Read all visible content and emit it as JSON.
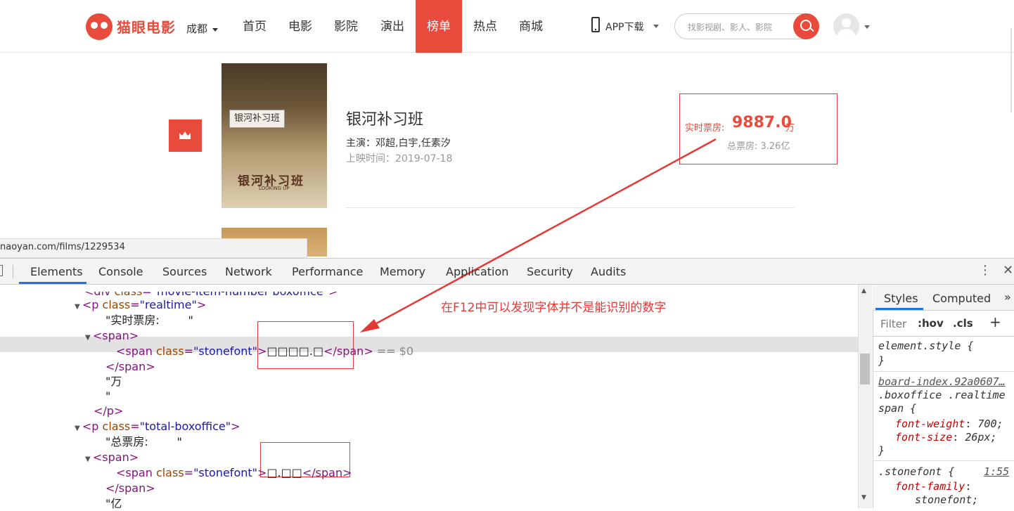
{
  "header": {
    "logo_text": "猫眼电影",
    "city": "成都",
    "nav": [
      "首页",
      "电影",
      "影院",
      "演出",
      "榜单",
      "热点",
      "商城"
    ],
    "active_nav": "榜单",
    "app_download": "APP下载",
    "search_placeholder": "找影视剧、影人、影院"
  },
  "movie": {
    "poster_tag": "银河补习班",
    "poster_title": "银河补习班",
    "poster_subtitle": "LOOKING UP",
    "title": "银河补习班",
    "cast": "主演：邓超,白宇,任素汐",
    "release": "上映时间：2019-07-18",
    "realtime_label": "实时票房:",
    "realtime_value": "9887.0",
    "realtime_unit": "万",
    "total_boxoffice": "总票房: 3.26亿"
  },
  "status_url": "naoyan.com/films/1229534",
  "devtools": {
    "tabs": [
      "Elements",
      "Console",
      "Sources",
      "Network",
      "Performance",
      "Memory",
      "Application",
      "Security",
      "Audits"
    ],
    "active_tab": "Elements",
    "code_lines": [
      {
        "indent": 120,
        "arrow": "",
        "parts": [
          [
            "tg",
            "<div "
          ],
          [
            "an",
            "class"
          ],
          [
            "tg",
            "="
          ],
          [
            "av",
            "\"movie-item-number boxoffice\""
          ],
          [
            "tg",
            ">"
          ]
        ],
        "cut": true
      },
      {
        "indent": 120,
        "arrow": "▼",
        "parts": [
          [
            "tg",
            "<p "
          ],
          [
            "an",
            "class"
          ],
          [
            "tg",
            "="
          ],
          [
            "av",
            "\"realtime\""
          ],
          [
            "tg",
            ">"
          ]
        ]
      },
      {
        "indent": 150,
        "arrow": "",
        "parts": [
          [
            "tx",
            "\"实时票房:        \""
          ]
        ]
      },
      {
        "indent": 135,
        "arrow": "▼",
        "parts": [
          [
            "tg",
            "<span>"
          ]
        ]
      },
      {
        "indent": 165,
        "arrow": "",
        "parts": [
          [
            "tg",
            "<span "
          ],
          [
            "an",
            "class"
          ],
          [
            "tg",
            "="
          ],
          [
            "av",
            "\"stonefont\""
          ],
          [
            "tg",
            ">"
          ],
          [
            "tx",
            "□□□□.□"
          ],
          [
            "tg",
            "</span>"
          ],
          [
            "gr",
            " == $0"
          ]
        ]
      },
      {
        "indent": 150,
        "arrow": "",
        "parts": [
          [
            "tg",
            "</span>"
          ]
        ]
      },
      {
        "indent": 150,
        "arrow": "",
        "parts": [
          [
            "tx",
            "\"万"
          ]
        ]
      },
      {
        "indent": 150,
        "arrow": "",
        "parts": [
          [
            "tx",
            "\""
          ]
        ]
      },
      {
        "indent": 133,
        "arrow": "",
        "parts": [
          [
            "tg",
            "</p>"
          ]
        ]
      },
      {
        "indent": 120,
        "arrow": "▼",
        "parts": [
          [
            "tg",
            "<p "
          ],
          [
            "an",
            "class"
          ],
          [
            "tg",
            "="
          ],
          [
            "av",
            "\"total-boxoffice\""
          ],
          [
            "tg",
            ">"
          ]
        ]
      },
      {
        "indent": 150,
        "arrow": "",
        "parts": [
          [
            "tx",
            "\"总票房:        \""
          ]
        ]
      },
      {
        "indent": 135,
        "arrow": "▼",
        "parts": [
          [
            "tg",
            "<span>"
          ]
        ]
      },
      {
        "indent": 165,
        "arrow": "",
        "parts": [
          [
            "tg",
            "<span "
          ],
          [
            "an",
            "class"
          ],
          [
            "tg",
            "="
          ],
          [
            "av",
            "\"stonefont\""
          ],
          [
            "tg",
            ">"
          ],
          [
            "tx",
            "□.□□"
          ],
          [
            "tg",
            "</span>"
          ]
        ]
      },
      {
        "indent": 150,
        "arrow": "",
        "parts": [
          [
            "tg",
            "</span>"
          ]
        ]
      },
      {
        "indent": 150,
        "arrow": "",
        "parts": [
          [
            "tx",
            "\"亿"
          ]
        ]
      }
    ],
    "styles": {
      "tabs": [
        "Styles",
        "Computed"
      ],
      "more": "»",
      "filter_placeholder": "Filter",
      "hov": ":hov",
      "cls": ".cls",
      "plus": "+",
      "element_style_open": "element.style {",
      "close_brace": "}",
      "rule1_source": "board-index.92a0607…",
      "rule1_selector_a": ".boxoffice .realtime",
      "rule1_selector_b": "span {",
      "rule1_decl1_prop": "font-weight",
      "rule1_decl1_val": "700;",
      "rule1_decl2_prop": "font-size",
      "rule1_decl2_val": "26px;",
      "rule2_selector": ".stonefont {",
      "rule2_source": "1:55",
      "rule2_decl_prop": "font-family",
      "rule2_decl_val": "stonefont;"
    }
  },
  "annotation": "在F12中可以发现字体并不是能识别的数字"
}
